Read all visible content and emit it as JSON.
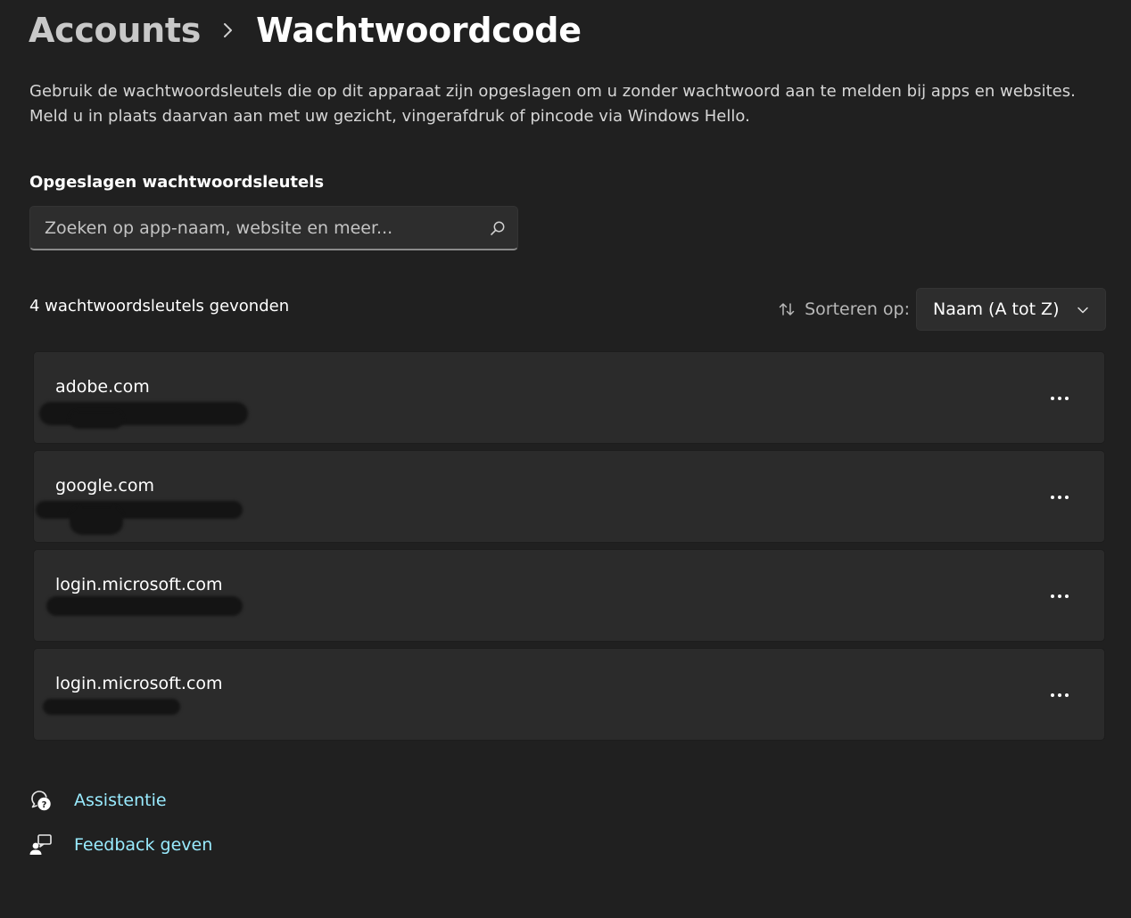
{
  "breadcrumb": {
    "parent": "Accounts",
    "current": "Wachtwoordcode"
  },
  "description": {
    "line1": "Gebruik de wachtwoordsleutels die op dit apparaat zijn opgeslagen om u zonder wachtwoord aan te melden bij apps en websites.",
    "line2": "Meld u in plaats daarvan aan met uw gezicht, vingerafdruk of pincode via Windows Hello."
  },
  "section_title": "Opgeslagen wachtwoordsleutels",
  "search": {
    "placeholder": "Zoeken op app-naam, website en meer...",
    "value": ""
  },
  "results_count": "4 wachtwoordsleutels gevonden",
  "sort": {
    "label": "Sorteren op:",
    "value": "Naam (A tot Z)"
  },
  "passkeys": [
    {
      "site": "adobe.com"
    },
    {
      "site": "google.com"
    },
    {
      "site": "login.microsoft.com"
    },
    {
      "site": "login.microsoft.com"
    }
  ],
  "help": {
    "assistance": "Assistentie",
    "feedback": "Feedback geven"
  },
  "colors": {
    "background": "#202020",
    "card": "#2b2b2b",
    "link": "#99ebff"
  }
}
